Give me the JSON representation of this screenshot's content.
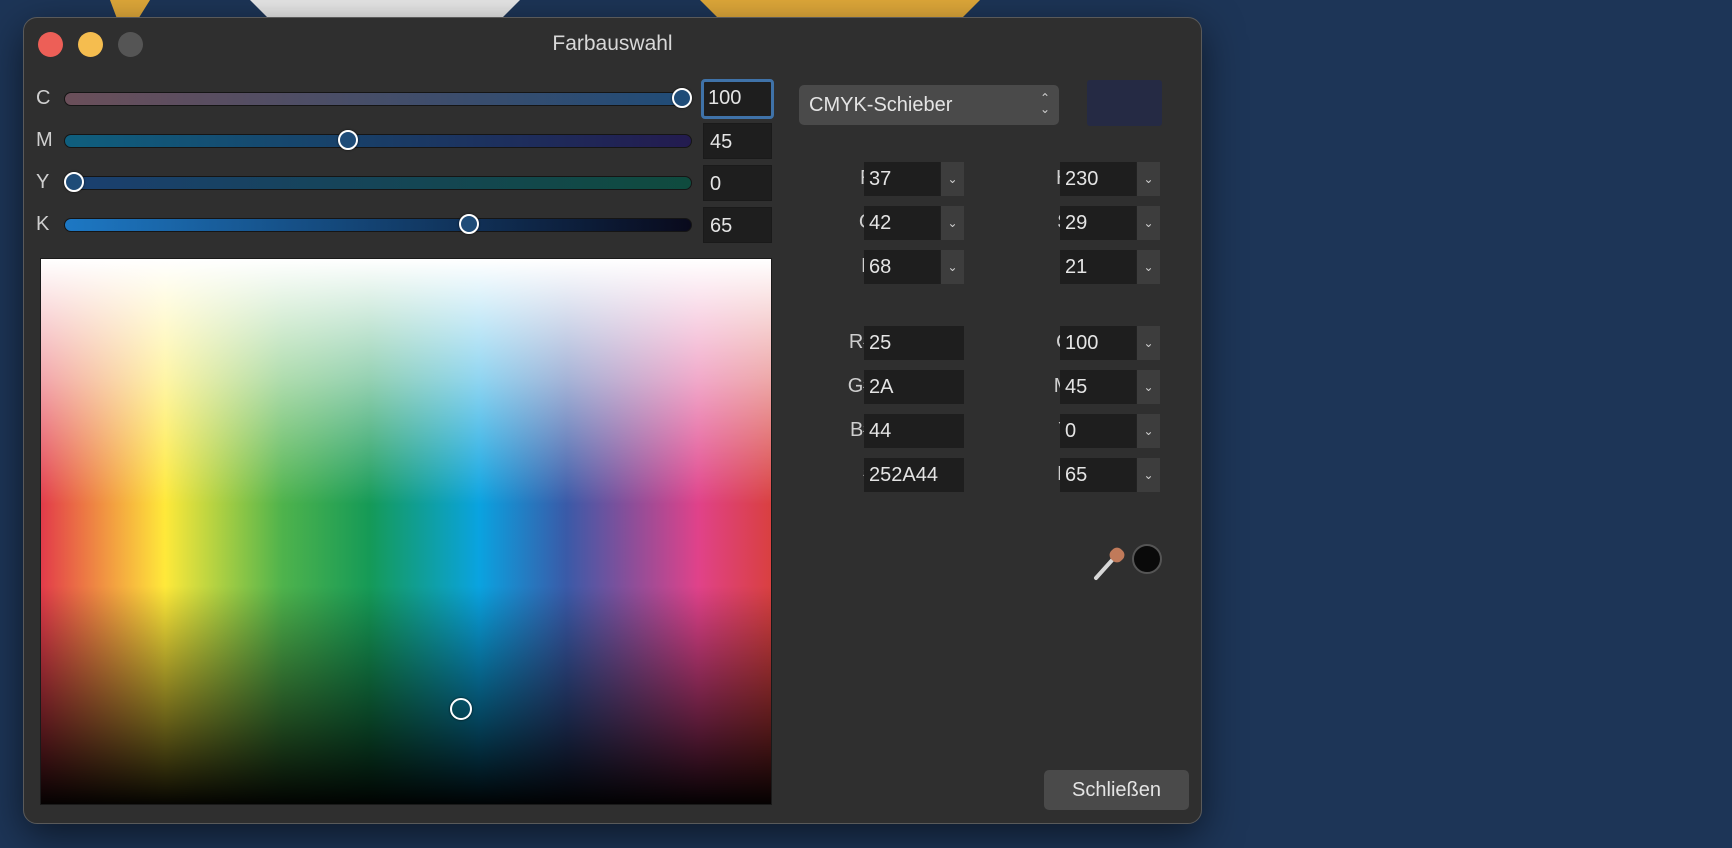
{
  "window": {
    "title": "Farbauswahl"
  },
  "sliders": [
    {
      "label": "C",
      "value": "100",
      "level": 1.0
    },
    {
      "label": "M",
      "value": "45",
      "level": 0.45
    },
    {
      "label": "Y",
      "value": "0",
      "level": 0.0
    },
    {
      "label": "K",
      "value": "65",
      "level": 0.65
    }
  ],
  "mode": {
    "selected": "CMYK-Schieber"
  },
  "color": {
    "current_hex": "#252A44"
  },
  "rgb": {
    "r": {
      "label": "R:",
      "value": "37"
    },
    "g": {
      "label": "G:",
      "value": "42"
    },
    "b": {
      "label": "B:",
      "value": "68"
    }
  },
  "hsl": {
    "h": {
      "label": "H:",
      "value": "230"
    },
    "s": {
      "label": "S:",
      "value": "29"
    },
    "l": {
      "label": "L:",
      "value": "21"
    }
  },
  "hex": {
    "r": {
      "label": "R#:",
      "value": "25"
    },
    "g": {
      "label": "G#:",
      "value": "2A"
    },
    "b": {
      "label": "B#:",
      "value": "44"
    },
    "full": {
      "label": "#:",
      "value": "252A44"
    }
  },
  "cmyk": {
    "c": {
      "label": "C:",
      "value": "100"
    },
    "m": {
      "label": "M:",
      "value": "45"
    },
    "y": {
      "label": "Y:",
      "value": "0"
    },
    "k": {
      "label": "K:",
      "value": "65"
    }
  },
  "buttons": {
    "close_label": "Schließen"
  },
  "icons": {
    "eyedropper": "eyedropper-icon",
    "stepper": "chevron-updown-icon",
    "dropdown": "chevron-down-icon"
  }
}
